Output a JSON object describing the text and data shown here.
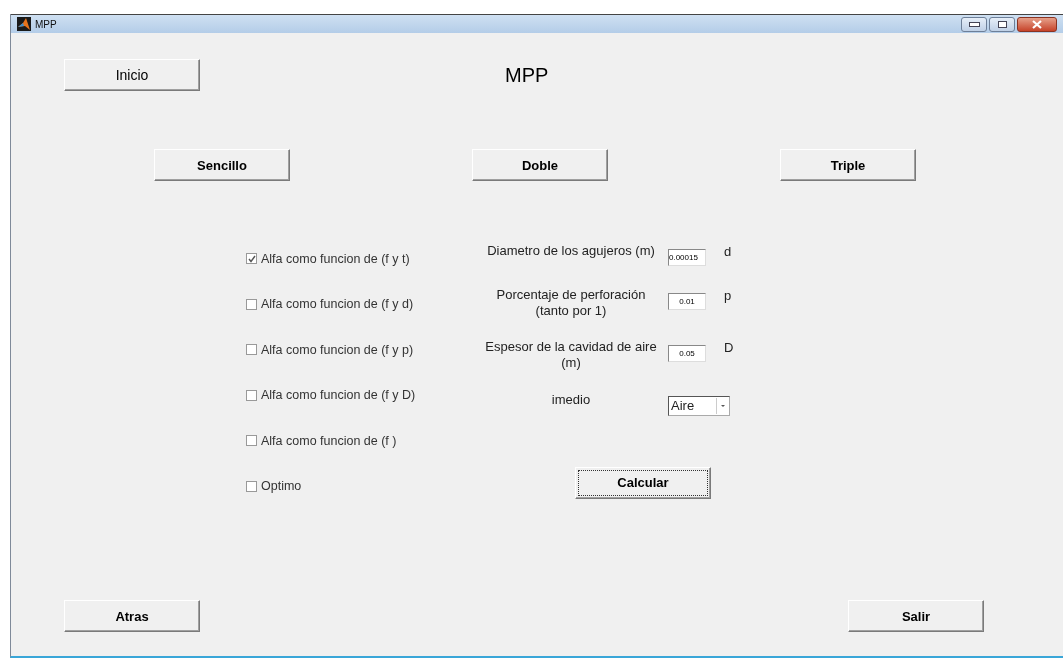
{
  "window": {
    "title": "MPP"
  },
  "nav_button": "Inicio",
  "title": "MPP",
  "mode_buttons": [
    "Sencillo",
    "Doble",
    "Triple"
  ],
  "options": [
    {
      "label": "Alfa como funcion de (f y t)",
      "checked": true
    },
    {
      "label": "Alfa como funcion de (f y d)",
      "checked": false
    },
    {
      "label": "Alfa como funcion de (f y p)",
      "checked": false
    },
    {
      "label": "Alfa como funcion de (f y D)",
      "checked": false
    },
    {
      "label": "Alfa como funcion de (f )",
      "checked": false
    },
    {
      "label": "Optimo",
      "checked": false
    }
  ],
  "parameters": [
    {
      "label": "Diametro de los agujeros (m)",
      "value": "0.00015",
      "symbol": "d"
    },
    {
      "label": "Porcentaje de perforación (tanto por 1)",
      "value": "0.01",
      "symbol": "p"
    },
    {
      "label": "Espesor de la cavidad de aire (m)",
      "value": "0.05",
      "symbol": "D"
    }
  ],
  "medium": {
    "label": "imedio",
    "value": "Aire"
  },
  "calculate_button": "Calcular",
  "footer_buttons": [
    "Atras",
    "Salir"
  ]
}
